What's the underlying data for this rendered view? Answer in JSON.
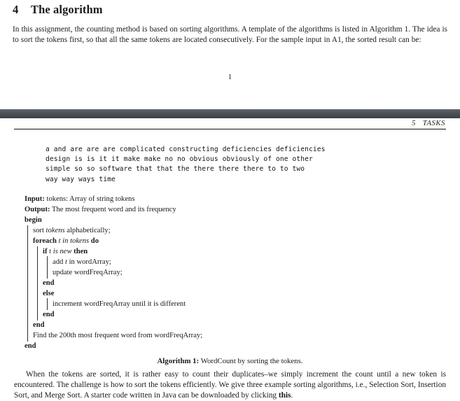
{
  "document": {
    "page_one": {
      "section_number": "4",
      "section_title": "The algorithm",
      "paragraph": "In this assignment, the counting method is based on sorting algorithms. A template of the algorithms is listed in Algorithm 1. The idea is to sort the tokens first, so that all the same tokens are located consecutively. For the sample input in A1, the sorted result can be:",
      "page_number": "1"
    },
    "page_two": {
      "running_head": {
        "number": "5",
        "title": "TASKS"
      },
      "verbatim_tokens": {
        "line1": "a and are are are complicated constructing deficiencies deficiencies",
        "line2": "design is is it it make make no no obvious obviously of one other",
        "line3": "simple so so software that that the there there there to to two",
        "line4": "way way ways time"
      },
      "algorithm": {
        "input_label": "Input:",
        "input_text": "tokens: Array of string tokens",
        "output_label": "Output:",
        "output_text": "The most frequent word and its frequency",
        "begin": "begin",
        "line_sort_kw": "sort",
        "line_sort_var": "tokens",
        "line_sort_rest": "alphabetically;",
        "foreach_kw": "foreach",
        "foreach_cond": "t in tokens",
        "foreach_do": "do",
        "if_kw": "if",
        "if_cond": "t is new",
        "if_then": "then",
        "add_line_a": "add",
        "add_line_var": "t",
        "add_line_b": "in wordArray;",
        "update_line": "update wordFreqArray;",
        "end_inner_if": "end",
        "else_kw": "else",
        "else_body": "increment wordFreqArray until it is different",
        "end_else": "end",
        "end_foreach": "end",
        "find_line": "Find the 200th most frequent word from wordFreqArray;",
        "end_outer": "end",
        "caption_label": "Algorithm 1:",
        "caption_text": "WordCount by sorting the tokens."
      },
      "closing_paragraph_part1": "When the tokens are sorted, it is rather easy to count their duplicates–we simply increment the count until a new token is encountered. The challenge is how to sort the tokens efficiently. We give three example sorting algorithms, i.e., Selection Sort, Insertion Sort, and Merge Sort. A starter code written in Java can be downloaded by clicking ",
      "closing_paragraph_link": "this",
      "closing_paragraph_part2": "."
    }
  },
  "colors": {
    "page_background": "#ffffff",
    "text": "#1a1a1a",
    "separator_top": "#5b6066",
    "separator_bottom": "#3c4046",
    "rule": "#111111"
  }
}
